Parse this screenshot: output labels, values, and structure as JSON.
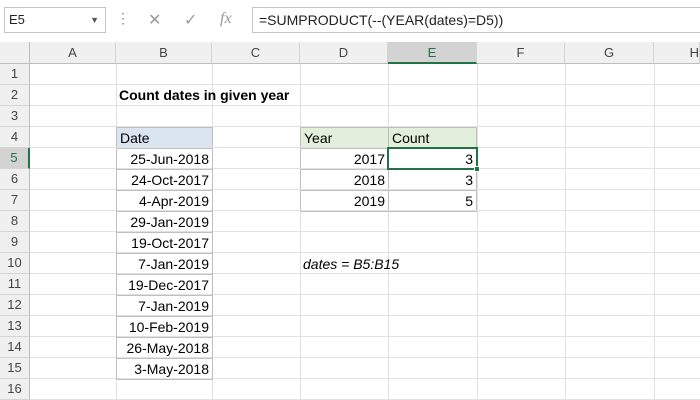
{
  "namebox": {
    "value": "E5"
  },
  "formula_bar": {
    "formula": "=SUMPRODUCT(--(YEAR(dates)=D5))",
    "fx_label": "fx"
  },
  "columns": [
    "A",
    "B",
    "C",
    "D",
    "E",
    "F",
    "G",
    "H"
  ],
  "rows": [
    "1",
    "2",
    "3",
    "4",
    "5",
    "6",
    "7",
    "8",
    "9",
    "10",
    "11",
    "12",
    "13",
    "14",
    "15",
    "16"
  ],
  "title": "Count dates in given year",
  "dates_table": {
    "header": "Date",
    "values": [
      "25-Jun-2018",
      "24-Oct-2017",
      "4-Apr-2019",
      "29-Jan-2019",
      "19-Oct-2017",
      "7-Jan-2019",
      "19-Dec-2017",
      "7-Jan-2019",
      "10-Feb-2019",
      "26-May-2018",
      "3-May-2018"
    ]
  },
  "summary_table": {
    "year_header": "Year",
    "count_header": "Count",
    "rows": [
      {
        "year": "2017",
        "count": "3"
      },
      {
        "year": "2018",
        "count": "3"
      },
      {
        "year": "2019",
        "count": "5"
      }
    ]
  },
  "note": "dates = B5:B15",
  "colors": {
    "accent": "#217346",
    "date_header_fill": "#dbe5f1",
    "summary_header_fill": "#e2efda"
  },
  "icons": {
    "cancel": "cancel-x-icon",
    "enter": "checkmark-icon",
    "function": "fx-icon"
  }
}
